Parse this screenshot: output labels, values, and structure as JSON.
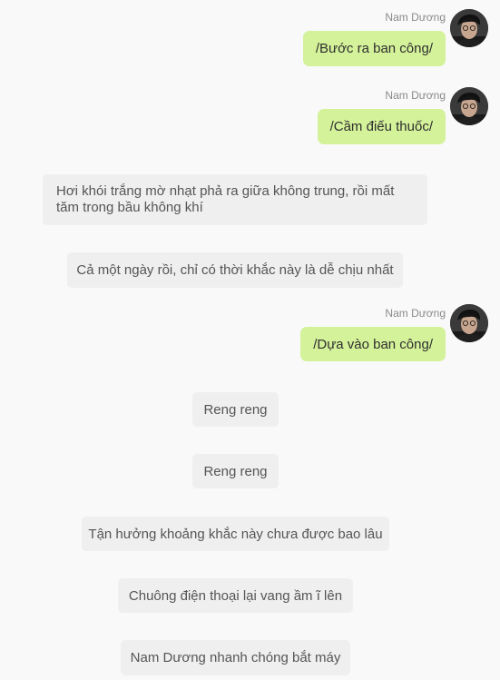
{
  "colors": {
    "user_bubble": "#d4f29a",
    "narration_bubble": "#efefef",
    "background": "#f9f9f9",
    "name_text": "#8a8a8a"
  },
  "messages": [
    {
      "type": "user",
      "sender": "Nam Dương",
      "avatar_icon": "user-avatar-icon",
      "text": "/Bước ra ban công/"
    },
    {
      "type": "user",
      "sender": "Nam Dương",
      "avatar_icon": "user-avatar-icon",
      "text": "/Cầm điếu thuốc/"
    },
    {
      "type": "narration",
      "text": "Hơi khói trắng mờ nhạt phả ra giữa không trung, rồi mất tăm trong bầu không khí"
    },
    {
      "type": "narration",
      "text": "Cả một ngày rồi, chỉ có thời khắc này là dễ chịu nhất"
    },
    {
      "type": "user",
      "sender": "Nam Dương",
      "avatar_icon": "user-avatar-icon",
      "text": "/Dựa vào ban công/"
    },
    {
      "type": "narration",
      "text": "Reng reng"
    },
    {
      "type": "narration",
      "text": "Reng reng"
    },
    {
      "type": "narration",
      "text": "Tận hưởng khoảng khắc này chưa được bao lâu"
    },
    {
      "type": "narration",
      "text": "Chuông điện thoại lại vang ầm ĩ lên"
    },
    {
      "type": "narration",
      "text": "Nam Dương nhanh chóng bắt máy"
    }
  ]
}
